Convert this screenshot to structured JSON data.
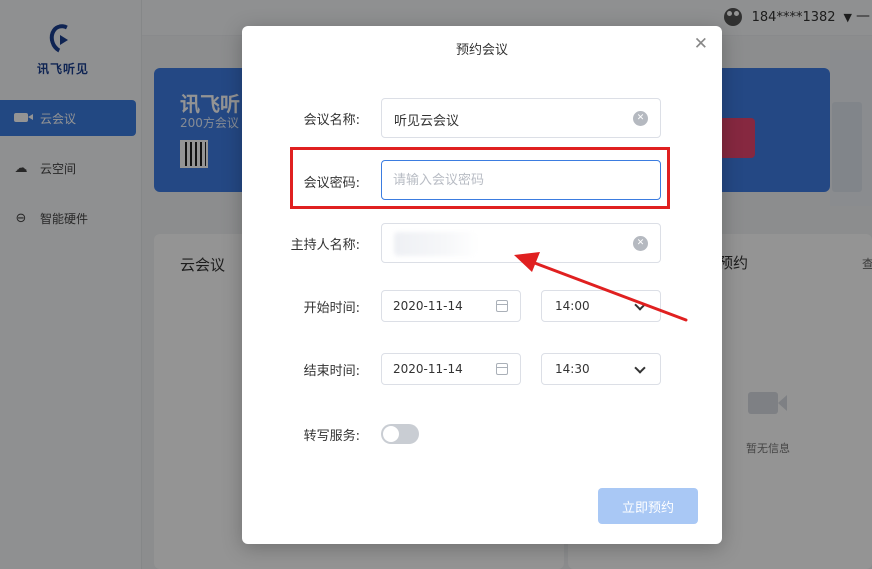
{
  "app": {
    "logo_text": "讯飞听见",
    "nav": [
      {
        "label": "云会议",
        "icon": "video-camera-icon",
        "active": true
      },
      {
        "label": "云空间",
        "icon": "cloud-icon",
        "active": false
      },
      {
        "label": "智能硬件",
        "icon": "device-icon",
        "active": false
      }
    ],
    "user": {
      "phone": "184****1382",
      "dropdown_glyph": "▼",
      "minimize_glyph": "—"
    },
    "banner": {
      "title": "讯飞听",
      "subtitle": "200方会议"
    },
    "cards": {
      "left_title": "云会议",
      "right_title": "预约",
      "right_link": "查",
      "empty_text": "暂无信息"
    }
  },
  "modal": {
    "title": "预约会议",
    "close_glyph": "✕",
    "meeting_name": {
      "label": "会议名称:",
      "value": "听见云会议"
    },
    "meeting_password": {
      "label": "会议密码:",
      "placeholder": "请输入会议密码"
    },
    "host_name": {
      "label": "主持人名称:"
    },
    "start": {
      "label": "开始时间:",
      "date": "2020-11-14",
      "time": "14:00"
    },
    "end": {
      "label": "结束时间:",
      "date": "2020-11-14",
      "time": "14:30"
    },
    "transcribe": {
      "label": "转写服务:",
      "enabled": false
    },
    "submit_label": "立即预约"
  },
  "colors": {
    "accent": "#3b7ce0",
    "annotation_red": "#e02020",
    "button_disabled": "#a9c8f5"
  }
}
